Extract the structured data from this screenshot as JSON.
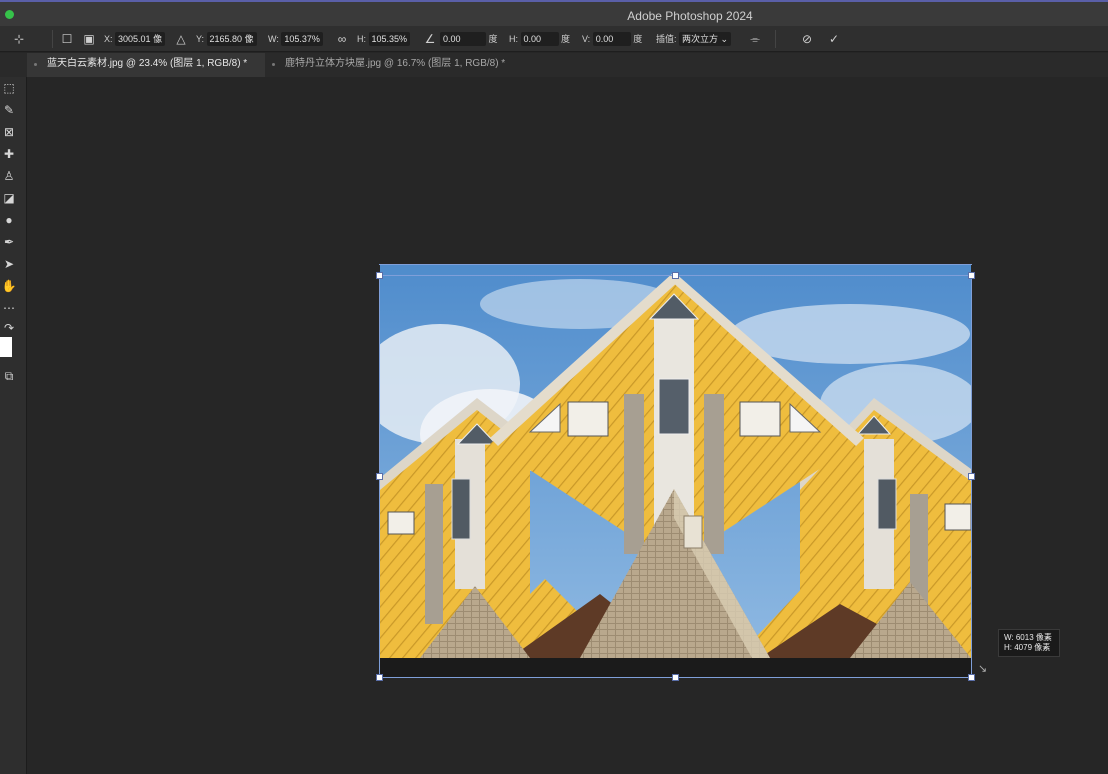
{
  "window": {
    "title": "Adobe Photoshop 2024"
  },
  "options": {
    "x_label": "X:",
    "x_value": "3005.01 像",
    "y_label": "Y:",
    "y_value": "2165.80 像",
    "w_label": "W:",
    "w_value": "105.37%",
    "h_label": "H:",
    "h_value": "105.35%",
    "angle_value": "0.00",
    "angle_unit": "度",
    "skew_h_label": "H:",
    "skew_h_value": "0.00",
    "skew_h_unit": "度",
    "skew_v_label": "V:",
    "skew_v_value": "0.00",
    "skew_v_unit": "度",
    "interp_label": "插值:",
    "interp_value": "两次立方"
  },
  "tabs": [
    {
      "label": "蓝天白云素材.jpg @ 23.4% (图层 1, RGB/8) *",
      "active": true
    },
    {
      "label": "鹿特丹立体方块屋.jpg @ 16.7% (图层 1, RGB/8) *",
      "active": false
    }
  ],
  "tooltip": {
    "w": "W: 6013 像素",
    "h": "H: 4079 像素"
  },
  "icons": {
    "cancel": "⃠",
    "commit": "✓"
  },
  "colors": {
    "accent": "#7f9fd9",
    "house": "#e8b83c",
    "sky": "#6fa2d6"
  }
}
